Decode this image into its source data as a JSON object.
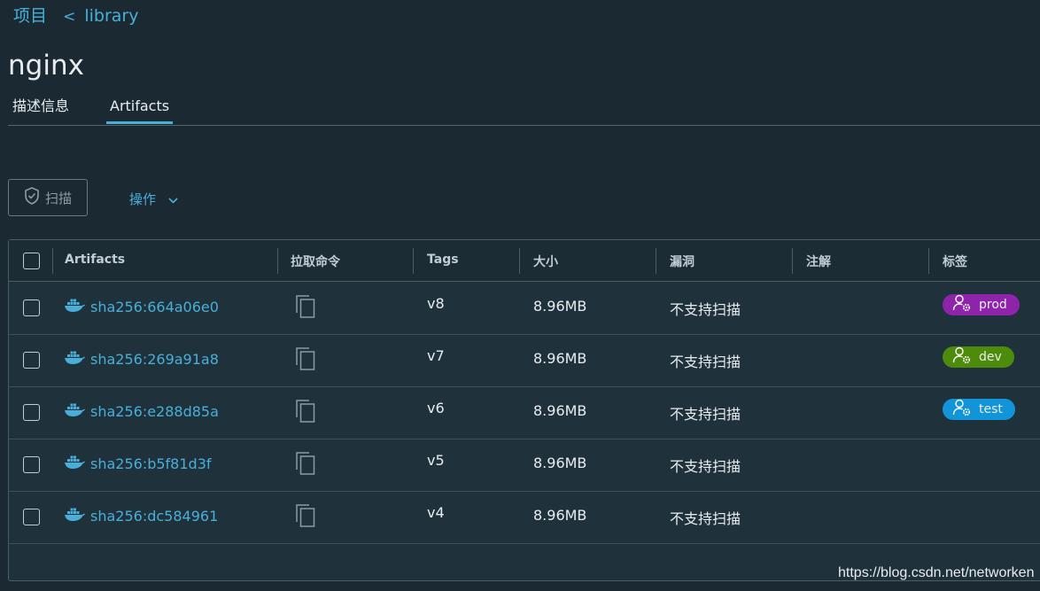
{
  "breadcrumb": {
    "root": "项目",
    "separator": "<",
    "current": "library"
  },
  "page_title": "nginx",
  "tabs": [
    {
      "label": "描述信息",
      "active": false
    },
    {
      "label": "Artifacts",
      "active": true
    }
  ],
  "toolbar": {
    "scan_label": "扫描",
    "action_label": "操作"
  },
  "grid": {
    "headers": [
      "Artifacts",
      "拉取命令",
      "Tags",
      "大小",
      "漏洞",
      "注解",
      "标签"
    ],
    "rows": [
      {
        "digest": "sha256:664a06e0",
        "tag": "v8",
        "size": "8.96MB",
        "vuln": "不支持扫描",
        "label": "prod",
        "label_color": "#8e24aa"
      },
      {
        "digest": "sha256:269a91a8",
        "tag": "v7",
        "size": "8.96MB",
        "vuln": "不支持扫描",
        "label": "dev",
        "label_color": "#4d8c0a"
      },
      {
        "digest": "sha256:e288d85a",
        "tag": "v6",
        "size": "8.96MB",
        "vuln": "不支持扫描",
        "label": "test",
        "label_color": "#1295d8"
      },
      {
        "digest": "sha256:b5f81d3f",
        "tag": "v5",
        "size": "8.96MB",
        "vuln": "不支持扫描",
        "label": "",
        "label_color": ""
      },
      {
        "digest": "sha256:dc584961",
        "tag": "v4",
        "size": "8.96MB",
        "vuln": "不支持扫描",
        "label": "",
        "label_color": ""
      }
    ]
  },
  "watermark": "https://blog.csdn.net/networken",
  "colors": {
    "background": "#1b2a32",
    "accent": "#49afd9",
    "border": "#4d5d66"
  }
}
